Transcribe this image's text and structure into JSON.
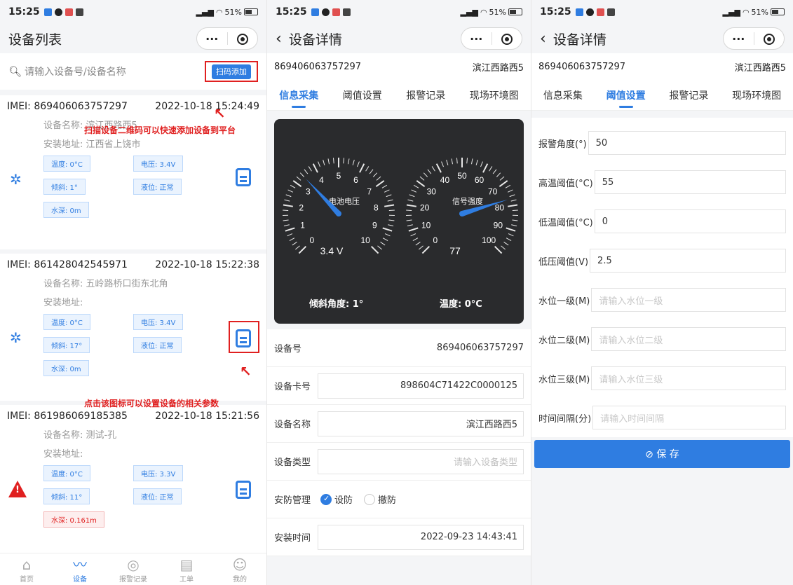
{
  "status": {
    "time": "15:25",
    "battery": "51%"
  },
  "list_page": {
    "title": "设备列表",
    "search_placeholder": "请输入设备号/设备名称",
    "scan_button": "扫码添加",
    "annotation_scan": "扫描设备二维码可以快速添加设备到平台",
    "annotation_icon": "点击该图标可以设置设备的相关参数",
    "devices": [
      {
        "imei": "IMEI: 869406063757297",
        "time": "2022-10-18 15:24:49",
        "name": "设备名称: 滨江西路西5",
        "address": "安装地址: 江西省上饶市",
        "temp": "温度: 0°C",
        "voltage": "电压: 3.4V",
        "tilt": "倾斜: 1°",
        "level": "液位: 正常",
        "depth": "水深: 0m",
        "status_icon": "loading-icon"
      },
      {
        "imei": "IMEI: 861428042545971",
        "time": "2022-10-18 15:22:38",
        "name": "设备名称: 五岭路桥口街东北角",
        "address": "安装地址:",
        "temp": "温度: 0°C",
        "voltage": "电压: 3.4V",
        "tilt": "倾斜: 17°",
        "level": "液位: 正常",
        "depth": "水深: 0m",
        "status_icon": "loading-icon"
      },
      {
        "imei": "IMEI: 861986069185385",
        "time": "2022-10-18 15:21:56",
        "name": "设备名称: 测试-孔",
        "address": "安装地址:",
        "temp": "温度: 0°C",
        "voltage": "电压: 3.3V",
        "tilt": "倾斜: 11°",
        "level": "液位: 正常",
        "depth": "水深: 0.161m",
        "status_icon": "warning-icon"
      }
    ],
    "tabbar": [
      "首页",
      "设备",
      "报警记录",
      "工单",
      "我的"
    ]
  },
  "detail_page": {
    "title": "设备详情",
    "device_id": "869406063757297",
    "device_name": "滨江西路西5",
    "tabs": [
      "信息采集",
      "阈值设置",
      "报警记录",
      "现场环境图"
    ],
    "gauge_battery": {
      "label": "电池电压",
      "value": 3.4,
      "reading": "3.4 V",
      "ticks": [
        "0",
        "1",
        "2",
        "3",
        "4",
        "5",
        "6",
        "7",
        "8",
        "9",
        "10"
      ]
    },
    "gauge_signal": {
      "label": "信号强度",
      "value": 77,
      "reading": "77",
      "ticks": [
        "0",
        "10",
        "20",
        "30",
        "40",
        "50",
        "60",
        "70",
        "80",
        "90",
        "100"
      ]
    },
    "tilt_label": "倾斜角度: 1°",
    "temp_label": "温度: 0°C",
    "fields": {
      "device_no_label": "设备号",
      "device_no": "869406063757297",
      "card_label": "设备卡号",
      "card": "898604C71422C0000125",
      "name_label": "设备名称",
      "name": "滨江西路西5",
      "type_label": "设备类型",
      "type_placeholder": "请输入设备类型",
      "security_label": "安防管理",
      "arm": "设防",
      "disarm": "撤防",
      "install_label": "安装时间",
      "install": "2022-09-23 14:43:41"
    }
  },
  "threshold_page": {
    "rows": [
      {
        "label": "报警角度(°)",
        "value": "50",
        "placeholder": ""
      },
      {
        "label": "高温阈值(°C)",
        "value": "55",
        "placeholder": ""
      },
      {
        "label": "低温阈值(°C)",
        "value": "0",
        "placeholder": ""
      },
      {
        "label": "低压阈值(V)",
        "value": "2.5",
        "placeholder": ""
      },
      {
        "label": "水位一级(M)",
        "value": "",
        "placeholder": "请输入水位一级"
      },
      {
        "label": "水位二级(M)",
        "value": "",
        "placeholder": "请输入水位二级"
      },
      {
        "label": "水位三级(M)",
        "value": "",
        "placeholder": "请输入水位三级"
      },
      {
        "label": "时间间隔(分)",
        "value": "",
        "placeholder": "请输入时间间隔"
      }
    ],
    "save_button": "⊘ 保 存"
  }
}
